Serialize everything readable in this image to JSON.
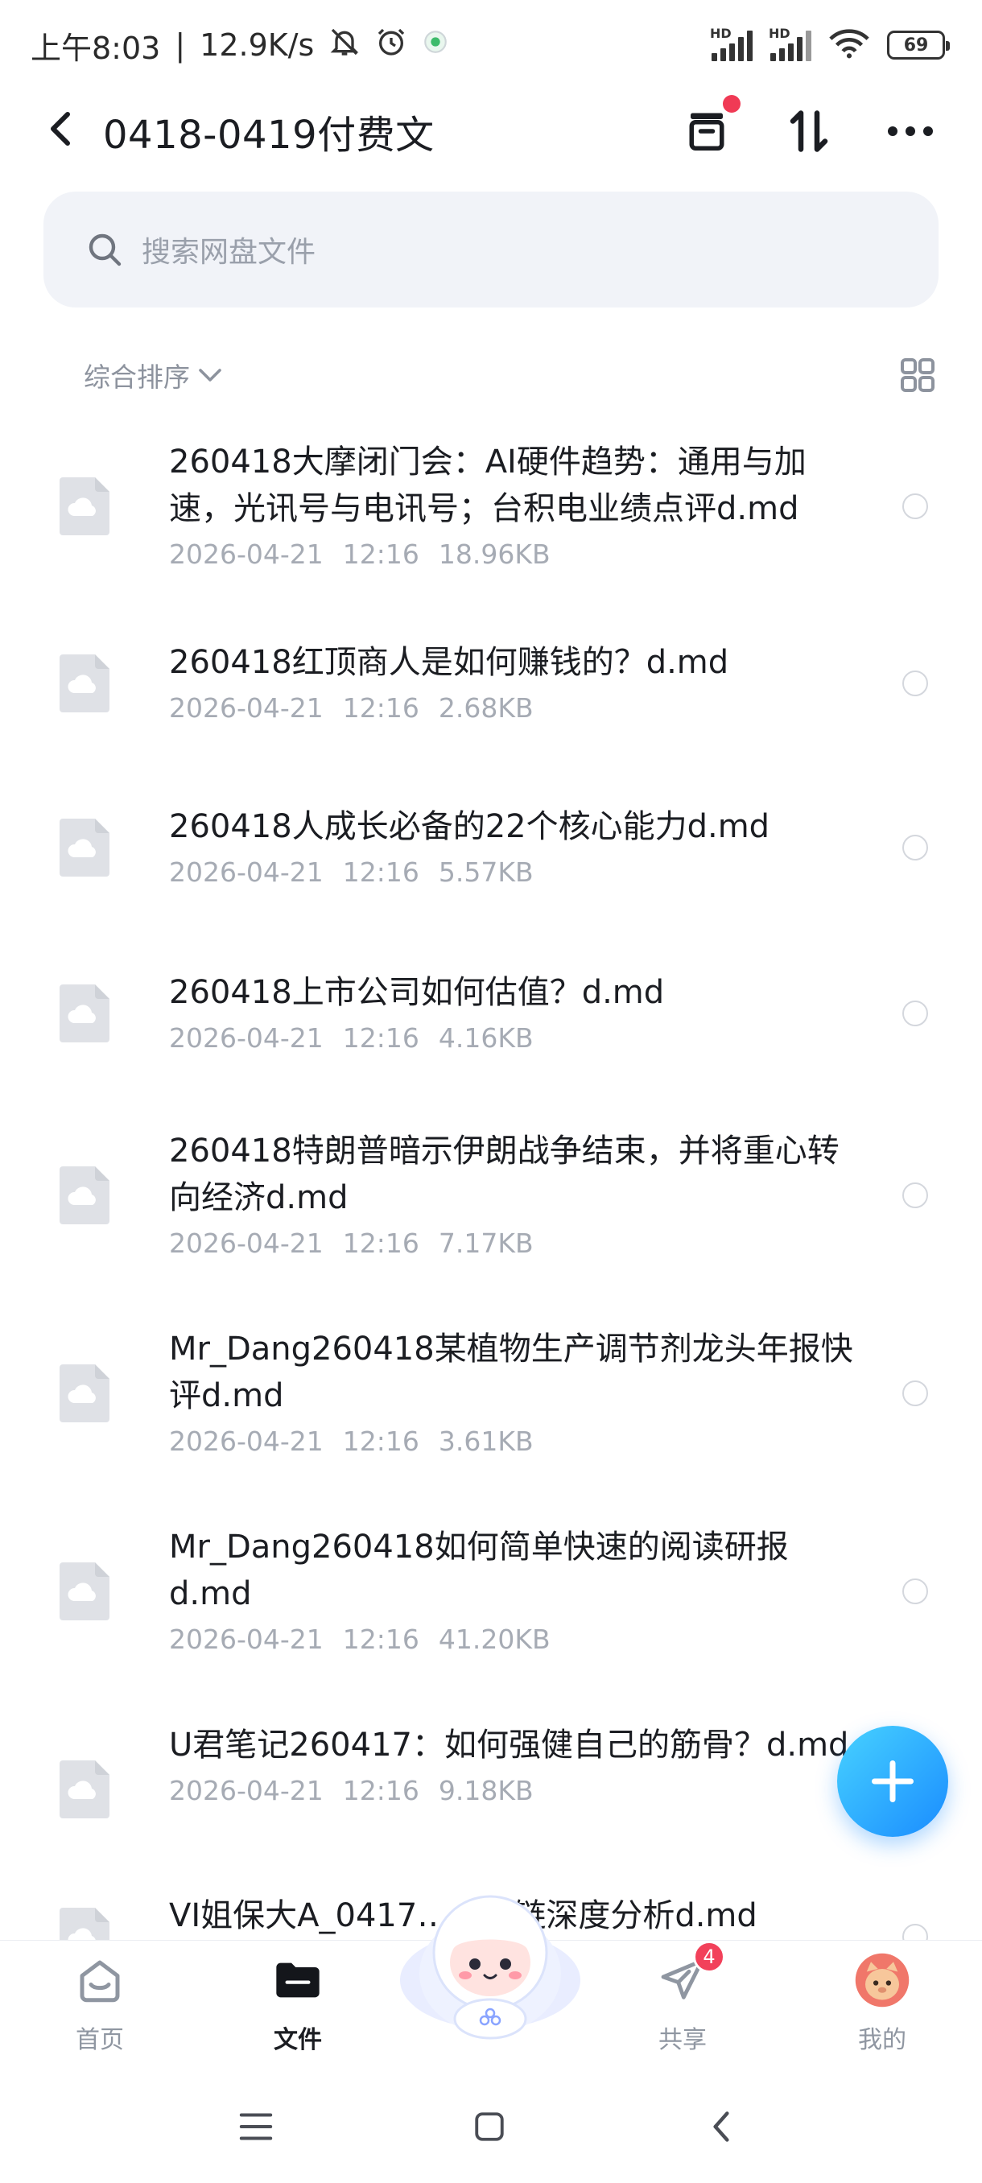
{
  "status_bar": {
    "time": "上午8:03",
    "speed": "12.9K/s",
    "hd1": "HD",
    "hd2": "HD",
    "battery": "69"
  },
  "header": {
    "title": "0418-0419付费文"
  },
  "search": {
    "placeholder": "搜索网盘文件"
  },
  "sort": {
    "label": "综合排序"
  },
  "files": [
    {
      "name": "260418大摩闭门会：AI硬件趋势：通用与加速，光讯号与电讯号；台积电业绩点评d.md",
      "date": "2026-04-21",
      "time": "12:16",
      "size": "18.96KB"
    },
    {
      "name": "260418红顶商人是如何赚钱的？d.md",
      "date": "2026-04-21",
      "time": "12:16",
      "size": "2.68KB"
    },
    {
      "name": "260418人成长必备的22个核心能力d.md",
      "date": "2026-04-21",
      "time": "12:16",
      "size": "5.57KB"
    },
    {
      "name": "260418上市公司如何估值？d.md",
      "date": "2026-04-21",
      "time": "12:16",
      "size": "4.16KB"
    },
    {
      "name": "260418特朗普暗示伊朗战争结束，并将重心转向经济d.md",
      "date": "2026-04-21",
      "time": "12:16",
      "size": "7.17KB"
    },
    {
      "name": "Mr_Dang260418某植物生产调节剂龙头年报快评d.md",
      "date": "2026-04-21",
      "time": "12:16",
      "size": "3.61KB"
    },
    {
      "name": "Mr_Dang260418如何简单快速的阅读研报d.md",
      "date": "2026-04-21",
      "time": "12:16",
      "size": "41.20KB"
    },
    {
      "name": "U君笔记260417：如何强健自己的筋骨？d.md",
      "date": "2026-04-21",
      "time": "12:16",
      "size": "9.18KB"
    },
    {
      "name": "VI姐保大A_0417……业链深度分析d.md",
      "date": "",
      "time": "",
      "size": ""
    }
  ],
  "nav": {
    "home": "首页",
    "files": "文件",
    "share": "共享",
    "share_badge": "4",
    "me": "我的"
  },
  "colors": {
    "accent": "#1a8cff",
    "badge": "#f2415a",
    "red_dot": "#f03a55"
  }
}
